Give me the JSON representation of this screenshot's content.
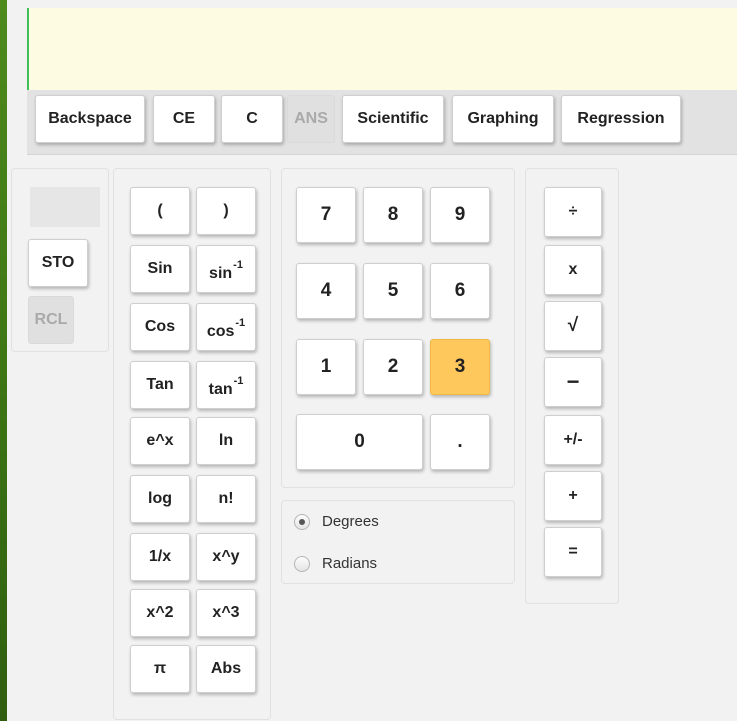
{
  "display": {
    "value": ""
  },
  "toolbar": {
    "backspace": "Backspace",
    "ce": "CE",
    "c": "C",
    "ans": "ANS",
    "scientific": "Scientific",
    "graphing": "Graphing",
    "regression": "Regression"
  },
  "memory": {
    "sto": "STO",
    "rcl": "RCL"
  },
  "functions": {
    "lparen": "(",
    "rparen": ")",
    "sin": "Sin",
    "asin_base": "sin",
    "asin_exp": "-1",
    "cos": "Cos",
    "acos_base": "cos",
    "acos_exp": "-1",
    "tan": "Tan",
    "atan_base": "tan",
    "atan_exp": "-1",
    "exp": "e^x",
    "ln": "ln",
    "log": "log",
    "fact": "n!",
    "recip": "1/x",
    "pow": "x^y",
    "sq": "x^2",
    "cube": "x^3",
    "pi": "π",
    "abs": "Abs"
  },
  "keypad": {
    "d7": "7",
    "d8": "8",
    "d9": "9",
    "d4": "4",
    "d5": "5",
    "d6": "6",
    "d1": "1",
    "d2": "2",
    "d3": "3",
    "d0": "0",
    "dot": "."
  },
  "angle": {
    "degrees": "Degrees",
    "radians": "Radians",
    "selected": "Degrees"
  },
  "operators": {
    "divide": "÷",
    "multiply": "x",
    "sqrt": "√",
    "minus": "−",
    "negate": "+/-",
    "plus": "+",
    "equals": "="
  },
  "colors": {
    "highlight": "#ffc85c",
    "display_bg": "#fdfbe1",
    "cursor": "#3fbf5a",
    "background": "#f2f2f2"
  }
}
